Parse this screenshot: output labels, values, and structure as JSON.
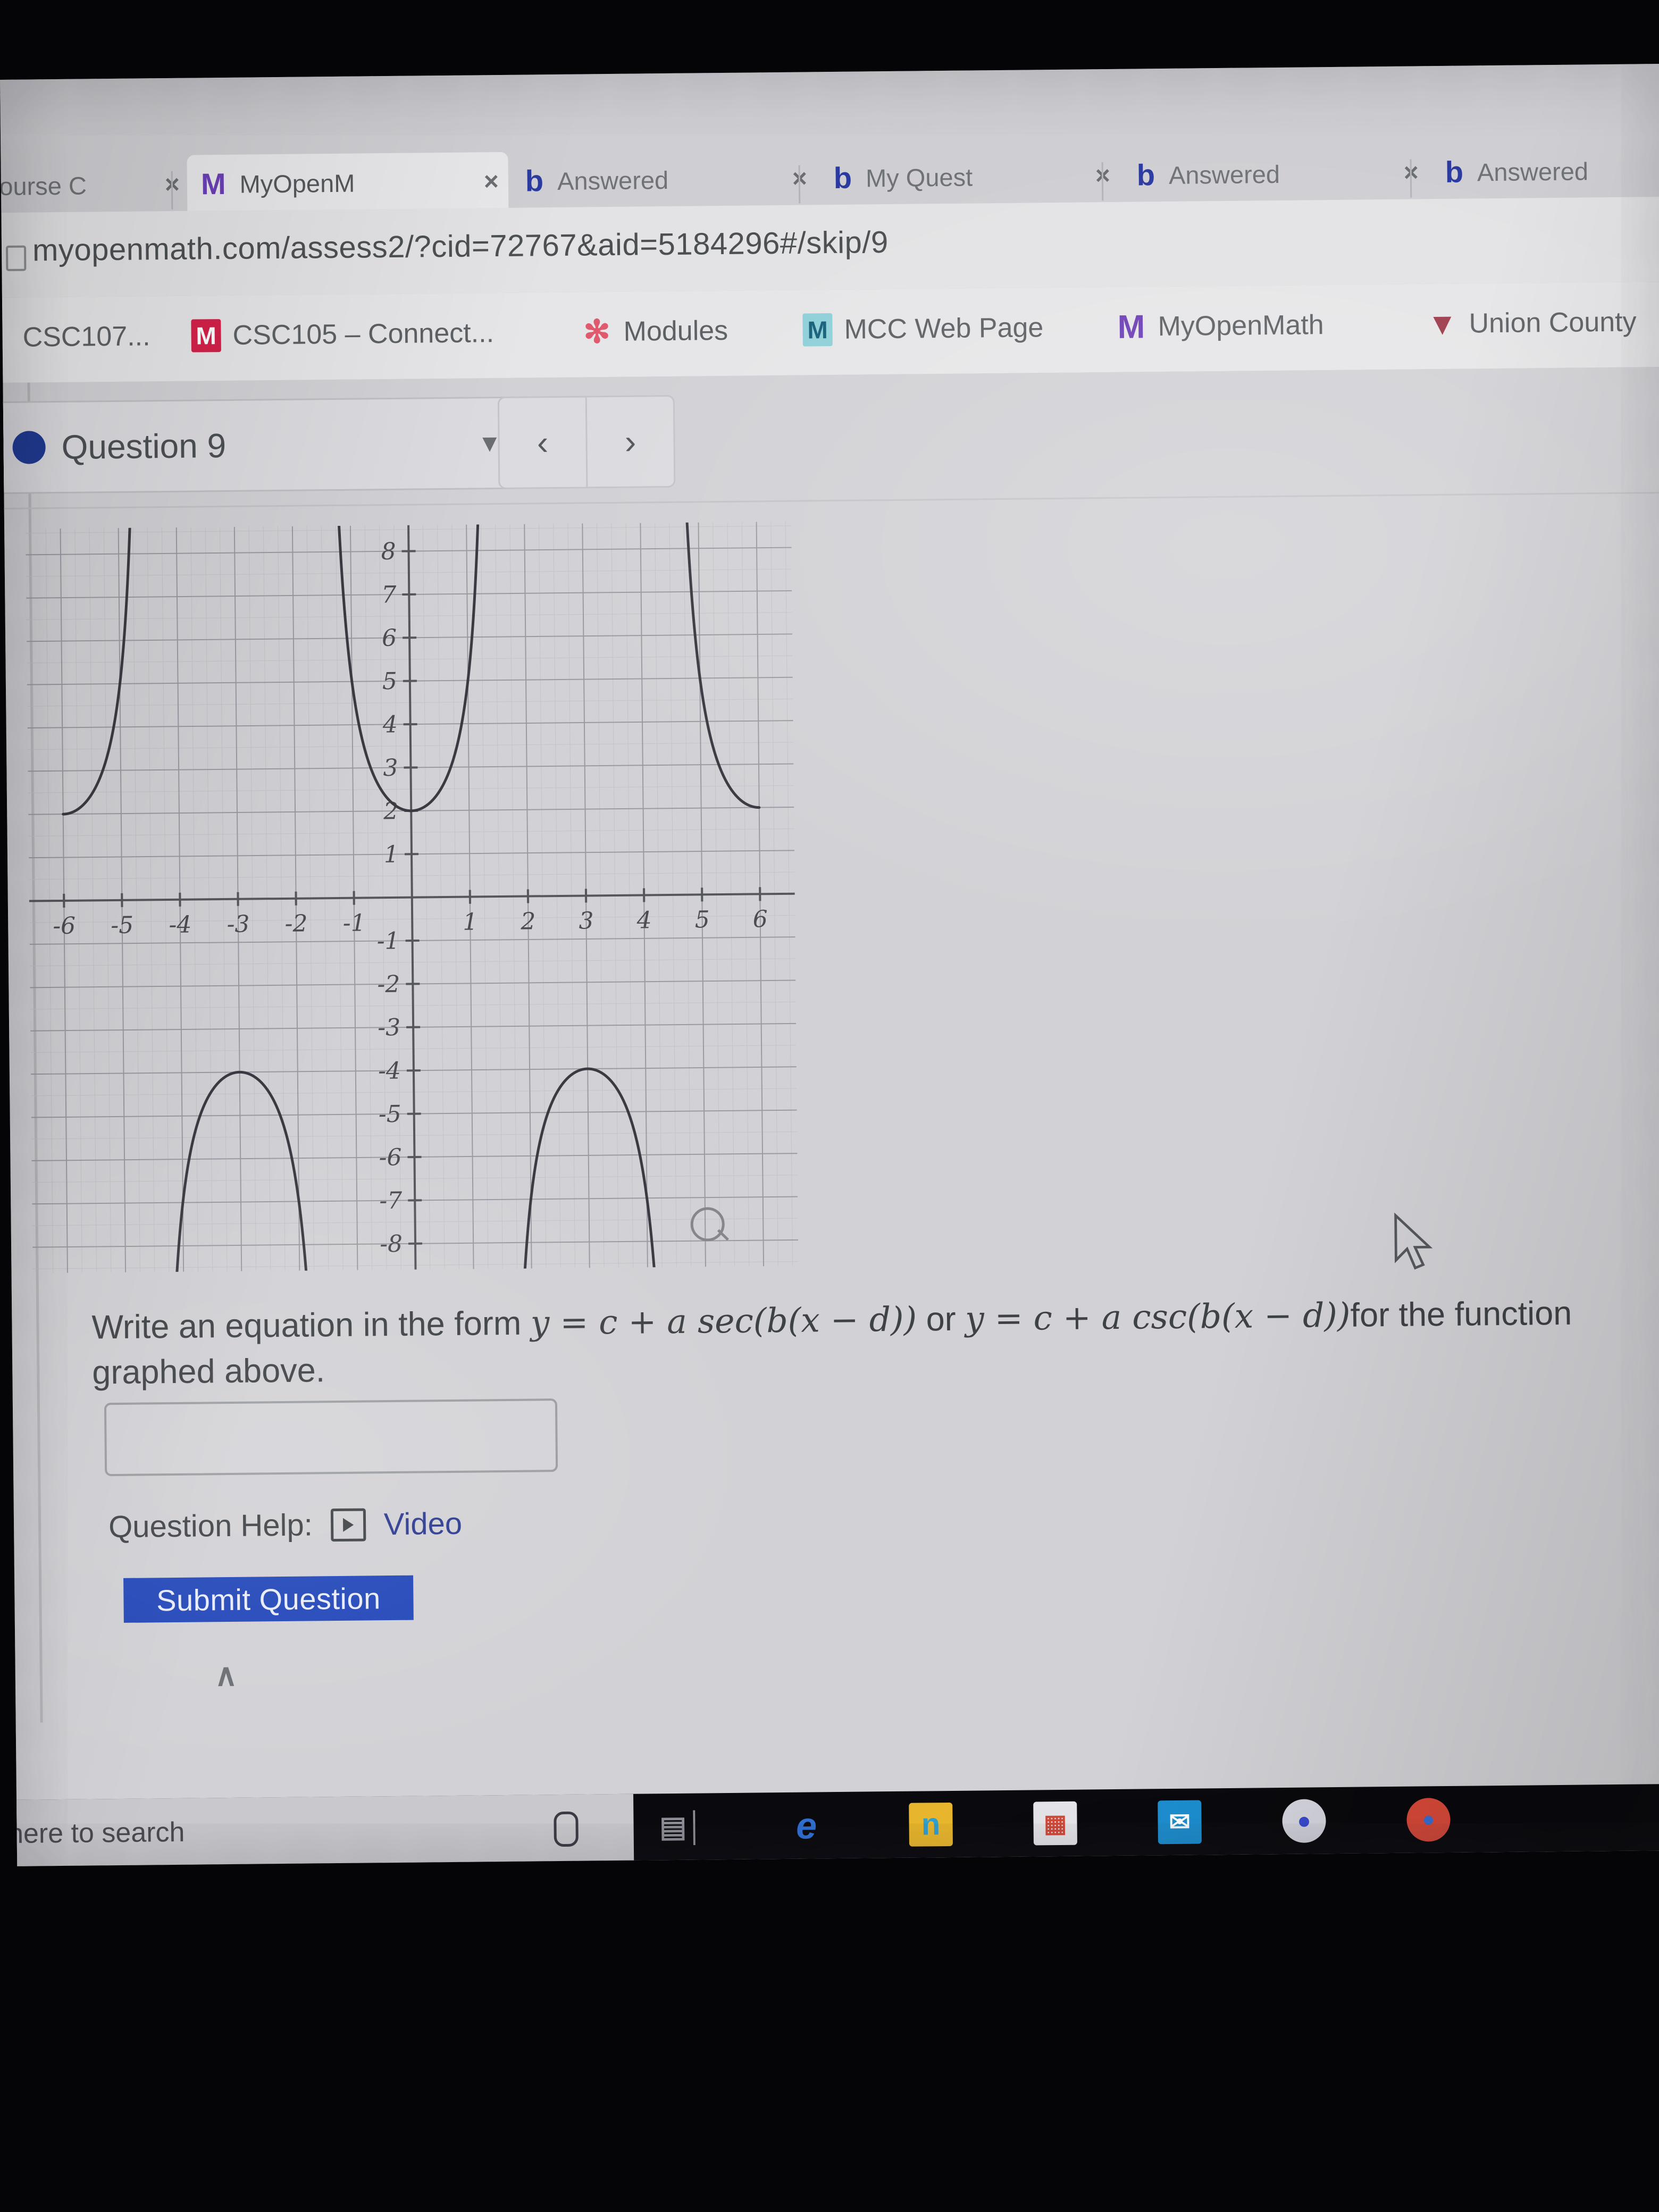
{
  "browser": {
    "tabs": [
      {
        "favicon": "C",
        "favicon_kind": "canvas-icon",
        "label": "Course C",
        "close": "×",
        "active": false
      },
      {
        "favicon": "M",
        "favicon_kind": "myopenmath-icon",
        "label": "MyOpenM",
        "close": "×",
        "active": true
      },
      {
        "favicon": "b",
        "favicon_kind": "bartleby-icon",
        "label": "Answered",
        "close": "×",
        "active": false
      },
      {
        "favicon": "b",
        "favicon_kind": "bartleby-icon",
        "label": "My Quest",
        "close": "×",
        "active": false
      },
      {
        "favicon": "b",
        "favicon_kind": "bartleby-icon",
        "label": "Answered",
        "close": "×",
        "active": false
      },
      {
        "favicon": "b",
        "favicon_kind": "bartleby-icon",
        "label": "Answered",
        "close": "",
        "active": false
      }
    ],
    "address_bar": {
      "url": "myopenmath.com/assess2/?cid=72767&aid=5184296#/skip/9"
    },
    "bookmarks": [
      {
        "icon": "",
        "icon_kind": "generic-bookmark-icon",
        "label": "CSC107..."
      },
      {
        "icon": "M",
        "icon_kind": "mcgraw-hill-icon",
        "label": "CSC105 – Connect..."
      },
      {
        "icon": "✻",
        "icon_kind": "canvas-modules-icon",
        "label": "Modules"
      },
      {
        "icon": "M",
        "icon_kind": "mcc-icon",
        "label": "MCC Web Page"
      },
      {
        "icon": "M",
        "icon_kind": "myopenmath-icon",
        "label": "MyOpenMath"
      },
      {
        "icon": "▼",
        "icon_kind": "union-county-shield-icon",
        "label": "Union County"
      }
    ]
  },
  "assessment": {
    "question_label": "Question 9",
    "dropdown_caret": "▼",
    "prev_label": "‹",
    "next_label": "›",
    "prompt_part1": "Write an equation in the form ",
    "prompt_eq1": "y = c + a sec(b(x − d))",
    "prompt_or": " or ",
    "prompt_eq2": "y = c + a csc(b(x − d))",
    "prompt_part2": "for the function graphed above.",
    "answer_value": "",
    "answer_placeholder": "",
    "help_label": "Question Help:",
    "video_label": "Video",
    "video_icon": "play-icon",
    "submit_label": "Submit Question",
    "collapse_icon": "∧",
    "zoom_icon": "magnifier-icon",
    "colors": {
      "submit_blue": "#2247b9",
      "link_blue": "#2b3a8f",
      "question_dot": "#1f3a93"
    }
  },
  "chart_data": {
    "type": "line",
    "title": "",
    "xlabel": "",
    "ylabel": "",
    "xlim": [
      -6.6,
      6.6
    ],
    "ylim": [
      -8.6,
      8.6
    ],
    "xticks": [
      -6,
      -5,
      -4,
      -3,
      -2,
      -1,
      1,
      2,
      3,
      4,
      5,
      6
    ],
    "yticks": [
      8,
      7,
      6,
      5,
      4,
      3,
      2,
      1,
      -1,
      -2,
      -3,
      -4,
      -5,
      -6,
      -7,
      -8
    ],
    "grid": true,
    "grid_minor": true,
    "function": "y = -1 + 3 sec(pi x / 3)",
    "equation_params": {
      "c": -1,
      "a": 3,
      "b": 1.0471975512,
      "d": 0,
      "period": 6
    },
    "asymptotes_x": [
      -4.5,
      -1.5,
      1.5,
      4.5
    ],
    "local_minima": [
      {
        "x": 0,
        "y": 2
      },
      {
        "x": -6,
        "y": 2
      },
      {
        "x": 6,
        "y": 2
      }
    ],
    "local_maxima": [
      {
        "x": -3,
        "y": -4
      },
      {
        "x": 3,
        "y": -4
      }
    ],
    "midline": -1,
    "amplitude": 3,
    "series": [
      {
        "name": "y = -1 + 3 sec(pi x / 3)",
        "color": "#3a3a42",
        "branches": [
          {
            "x_range": [
              -6.0,
              -4.5
            ],
            "note": "descending-to-asymptote branch, min at (-6, 2)"
          },
          {
            "x_range": [
              -1.5,
              1.5
            ],
            "note": "upward U branch, min at (0, 2)"
          },
          {
            "x_range": [
              4.5,
              6.0
            ],
            "note": "descending branch, min at (6, 2)"
          },
          {
            "x_range": [
              -4.5,
              -1.5
            ],
            "note": "downward branch, max at (-3, -4)"
          },
          {
            "x_range": [
              1.5,
              4.5
            ],
            "note": "downward branch, max at (3, -4)"
          }
        ]
      }
    ]
  },
  "taskbar": {
    "search_placeholder": "e here to search",
    "mic_icon": "⬜",
    "items": [
      {
        "name": "task-view-icon",
        "glyph": "☲",
        "color": "#8d8d95",
        "bg": "transparent"
      },
      {
        "name": "edge-icon",
        "glyph": "e",
        "color": "#2f6fd0",
        "bg": "transparent"
      },
      {
        "name": "file-explorer-icon",
        "glyph": "n",
        "color": "#2f9fd0",
        "bg": "#e8b62c"
      },
      {
        "name": "microsoft-store-icon",
        "glyph": "▦",
        "color": "#d04a3a",
        "bg": "#e8e8ea"
      },
      {
        "name": "mail-icon",
        "glyph": "✉",
        "color": "#ffffff",
        "bg": "#1d8fd0"
      },
      {
        "name": "office-icon",
        "glyph": "●",
        "color": "#3a4ad0",
        "bg": "#d9dae2"
      },
      {
        "name": "chrome-icon",
        "glyph": "●",
        "color": "#3a6fd0",
        "bg": "#d94a3a"
      }
    ]
  }
}
